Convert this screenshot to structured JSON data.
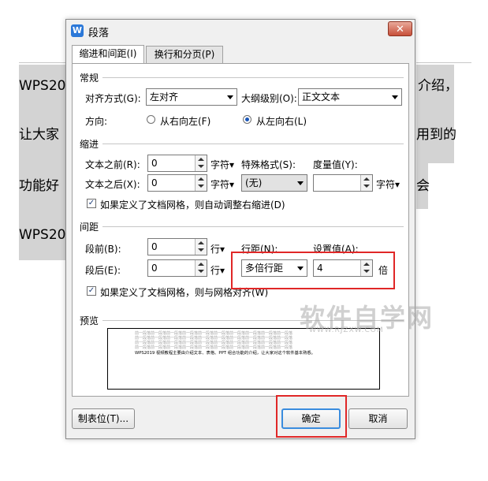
{
  "document": {
    "line1_left": "WPS201",
    "line1_right": "介绍，",
    "line2_left": "让大家",
    "line2_right": "用到的",
    "line3_left": "功能好",
    "line3_right": "会",
    "line4_left": "WPS201"
  },
  "dialog": {
    "app_icon_letter": "W",
    "title": "段落",
    "close_label": "✕",
    "tabs": [
      "缩进和间距(I)",
      "换行和分页(P)"
    ],
    "general": {
      "heading": "常规",
      "align_label": "对齐方式(G):",
      "align_value": "左对齐",
      "outline_label": "大纲级别(O):",
      "outline_value": "正文文本",
      "direction_label": "方向:",
      "rtl_label": "从右向左(F)",
      "ltr_label": "从左向右(L)"
    },
    "indent": {
      "heading": "缩进",
      "before_label": "文本之前(R):",
      "before_value": "0",
      "after_label": "文本之后(X):",
      "after_value": "0",
      "unit": "字符▾",
      "special_label": "特殊格式(S):",
      "special_value": "(无)",
      "measure_label": "度量值(Y):",
      "measure_value": "",
      "measure_unit": "字符▾",
      "grid_check": "如果定义了文档网格，则自动调整右缩进(D)"
    },
    "spacing": {
      "heading": "间距",
      "before_label": "段前(B):",
      "before_value": "0",
      "after_label": "段后(E):",
      "after_value": "0",
      "unit": "行▾",
      "line_label": "行距(N):",
      "line_value": "多倍行距",
      "setting_label": "设置值(A):",
      "setting_value": "4",
      "setting_unit": "倍",
      "grid_check": "如果定义了文档网格，则与网格对齐(W)"
    },
    "preview": {
      "heading": "预览",
      "filler_line": "前一段落前一段落前一段落前一段落前一段落前一段落前一段落前一段落前一段落前一段落",
      "main_line": "WPS2019 视频教程主要由介绍文本、表格、PPT 组合功能的介绍，让大家对这个软件基本熟悉。"
    },
    "buttons": {
      "tabs": "制表位(T)...",
      "ok": "确定",
      "cancel": "取消"
    },
    "check_mark": "✓"
  },
  "watermark": {
    "main": "软件自学网",
    "sub": "WWW.RJZXW.COM"
  },
  "colors": {
    "highlight": "#e02727",
    "selection": "#d3d3d3",
    "primary_border": "#3a8cde"
  }
}
